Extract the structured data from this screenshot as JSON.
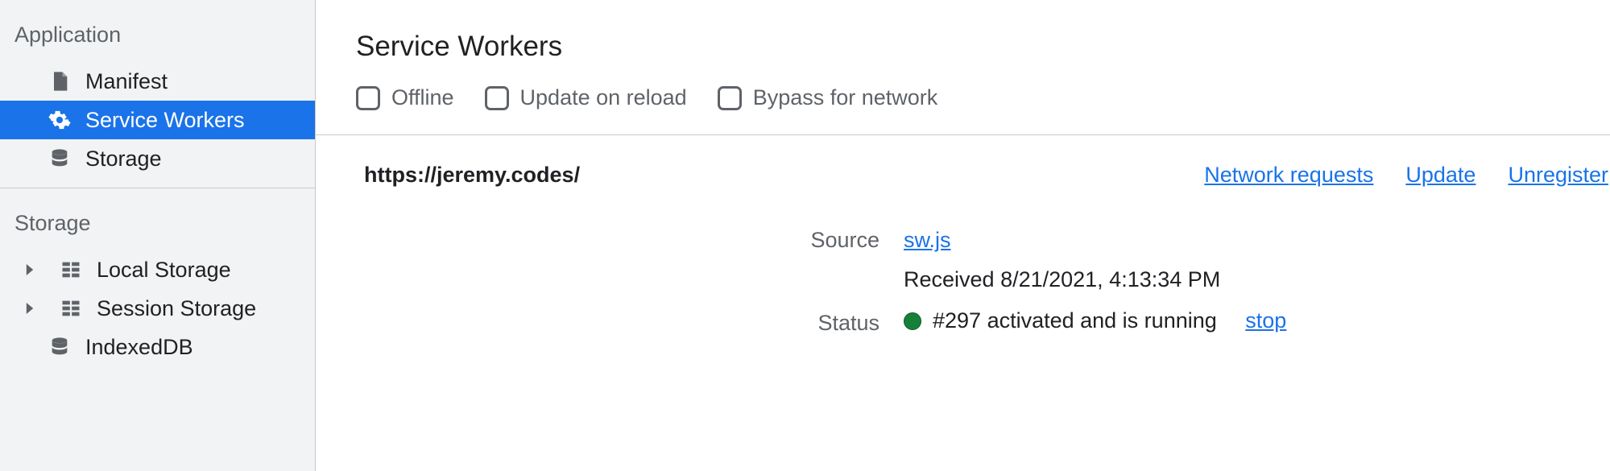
{
  "sidebar": {
    "section_application": "Application",
    "section_storage": "Storage",
    "items": {
      "manifest": "Manifest",
      "service_workers": "Service Workers",
      "storage": "Storage",
      "local_storage": "Local Storage",
      "session_storage": "Session Storage",
      "indexeddb": "IndexedDB"
    }
  },
  "main": {
    "title": "Service Workers",
    "checkboxes": {
      "offline": "Offline",
      "update_on_reload": "Update on reload",
      "bypass_for_network": "Bypass for network"
    },
    "scope": "https://jeremy.codes/",
    "actions": {
      "network_requests": "Network requests",
      "update": "Update",
      "unregister": "Unregister"
    },
    "labels": {
      "source": "Source",
      "status": "Status"
    },
    "source_file": "sw.js",
    "received_text": "Received 8/21/2021, 4:13:34 PM",
    "status_text": "#297 activated and is running",
    "status_stop": "stop"
  }
}
